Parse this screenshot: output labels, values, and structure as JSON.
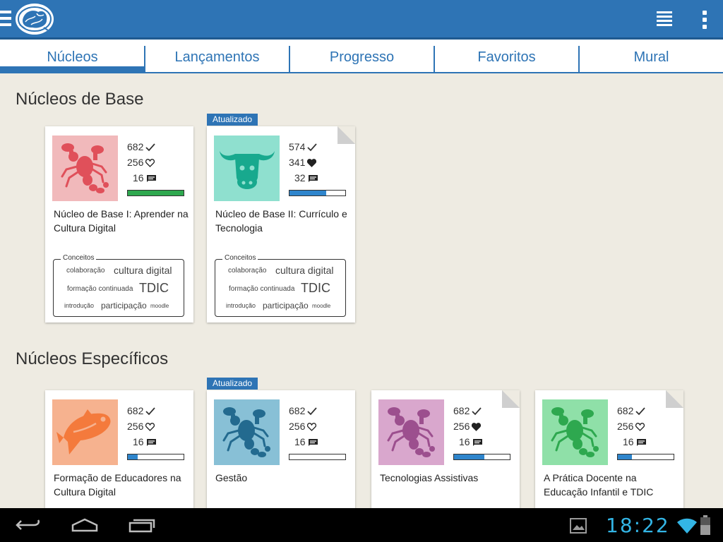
{
  "tabs": [
    {
      "label": "Núcleos"
    },
    {
      "label": "Lançamentos"
    },
    {
      "label": "Progresso"
    },
    {
      "label": "Favoritos"
    },
    {
      "label": "Mural"
    }
  ],
  "sections": {
    "base": "Núcleos de Base",
    "especificos": "Núcleos Específicos"
  },
  "badge_label": "Atualizado",
  "concepts_label": "Conceitos",
  "concept_tags": [
    "colaboração",
    "cultura digital",
    "formação continuada",
    "TDIC",
    "introdução",
    "participação",
    "moodle"
  ],
  "cards": [
    {
      "title": "Núcleo de Base I: Aprender na Cultura Digital",
      "completed": "682",
      "favorites": "256",
      "comments": "16",
      "progress": 1.0,
      "progress_color": "#2ea84f",
      "thumb_bg": "#f1b9bb",
      "icon_color": "#e0505a",
      "icon": "scorpion-icon",
      "heart": "outline"
    },
    {
      "title": "Núcleo de Base II: Currículo e Tecnologia",
      "completed": "574",
      "favorites": "341",
      "comments": "32",
      "progress": 0.66,
      "progress_color": "#2e85cc",
      "thumb_bg": "#8fe0cf",
      "icon_color": "#18a98e",
      "icon": "bull-icon",
      "heart": "filled",
      "updated": true,
      "folded": true
    },
    {
      "title": "Formação de Educadores na Cultura Digital",
      "completed": "682",
      "favorites": "256",
      "comments": "16",
      "progress": 0.18,
      "progress_color": "#2e85cc",
      "thumb_bg": "#f6b28f",
      "icon_color": "#f47a3c",
      "icon": "fish-icon",
      "heart": "outline"
    },
    {
      "title": "Gestão",
      "completed": "682",
      "favorites": "256",
      "comments": "16",
      "progress": 0.0,
      "progress_color": "#2e85cc",
      "thumb_bg": "#88c0d6",
      "icon_color": "#236a8f",
      "icon": "scorpion-icon",
      "heart": "outline",
      "updated": true
    },
    {
      "title": "Tecnologias Assistivas",
      "completed": "682",
      "favorites": "256",
      "comments": "16",
      "progress": 0.55,
      "progress_color": "#2e85cc",
      "thumb_bg": "#d9a7cd",
      "icon_color": "#9c4f8e",
      "icon": "scorpion-icon",
      "heart": "filled",
      "folded": true
    },
    {
      "title": "A Prática Docente na Educação Infantil e TDIC",
      "completed": "682",
      "favorites": "256",
      "comments": "16",
      "progress": 0.25,
      "progress_color": "#2e85cc",
      "thumb_bg": "#8fe0a8",
      "icon_color": "#2ea84f",
      "icon": "scorpion-icon",
      "heart": "outline",
      "folded": true
    }
  ],
  "system": {
    "clock": "18:22"
  }
}
